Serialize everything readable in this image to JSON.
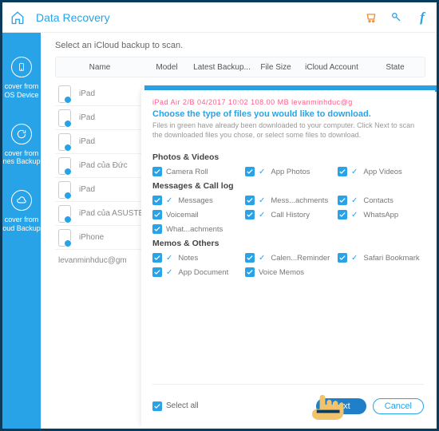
{
  "header": {
    "title": "Data Recovery"
  },
  "sidebar": {
    "items": [
      {
        "label": "cover from\nOS Device"
      },
      {
        "label": "cover from\nnes Backup"
      },
      {
        "label": "cover from\noud Backup"
      }
    ]
  },
  "main": {
    "instruction": "Select an iCloud backup to scan.",
    "columns": {
      "name": "Name",
      "model": "Model",
      "latest": "Latest Backup...",
      "size": "File Size",
      "account": "iCloud Account",
      "state": "State"
    },
    "rows": [
      {
        "name": "iPad"
      },
      {
        "name": "iPad"
      },
      {
        "name": "iPad"
      },
      {
        "name": "iPad của Đức"
      },
      {
        "name": "iPad"
      },
      {
        "name": "iPad của ASUSTEK"
      },
      {
        "name": "iPhone"
      }
    ],
    "account_line": "levanminhduc@gm"
  },
  "dialog": {
    "peek": "iPad Air 2/B       04/2017  10:02     108.00 MB   levanminhduc@g",
    "title": "Choose the type of files you would like to download.",
    "subtitle": "Files in green have already been downloaded to your computer. Click  Next  to scan the downloaded files you chose, or select some files to download.",
    "groups": [
      {
        "title": "Photos & Videos",
        "options": [
          {
            "label": "Camera Roll",
            "checked": true,
            "tick": false
          },
          {
            "label": "App Photos",
            "checked": true,
            "tick": true
          },
          {
            "label": "App Videos",
            "checked": true,
            "tick": true
          }
        ]
      },
      {
        "title": "Messages & Call log",
        "options": [
          {
            "label": "Messages",
            "checked": true,
            "tick": true
          },
          {
            "label": "Mess...achments",
            "checked": true,
            "tick": true
          },
          {
            "label": "Contacts",
            "checked": true,
            "tick": true
          },
          {
            "label": "Voicemail",
            "checked": true,
            "tick": false
          },
          {
            "label": "Call History",
            "checked": true,
            "tick": true
          },
          {
            "label": "WhatsApp",
            "checked": true,
            "tick": true
          },
          {
            "label": "What...achments",
            "checked": true,
            "tick": false
          }
        ]
      },
      {
        "title": "Memos & Others",
        "options": [
          {
            "label": "Notes",
            "checked": true,
            "tick": true
          },
          {
            "label": "Calen...Reminder",
            "checked": true,
            "tick": true
          },
          {
            "label": "Safari Bookmark",
            "checked": true,
            "tick": true
          },
          {
            "label": "App Document",
            "checked": true,
            "tick": true
          },
          {
            "label": "Voice Memos",
            "checked": true,
            "tick": false
          }
        ]
      }
    ],
    "select_all": "Select all",
    "next": "Next",
    "cancel": "Cancel"
  }
}
